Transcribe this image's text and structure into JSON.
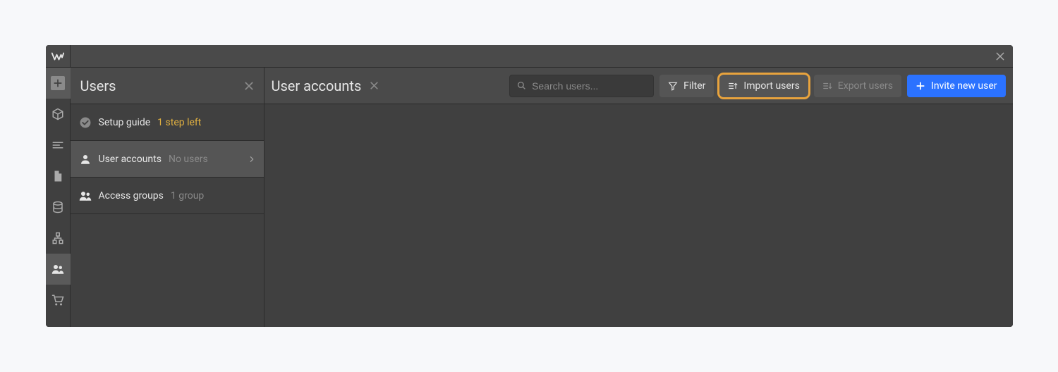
{
  "sidebar": {
    "title": "Users",
    "rows": [
      {
        "label": "Setup guide",
        "meta": "1 step left",
        "metaHighlight": true
      },
      {
        "label": "User accounts",
        "meta": "No users",
        "metaHighlight": false
      },
      {
        "label": "Access groups",
        "meta": "1 group",
        "metaHighlight": false
      }
    ]
  },
  "main": {
    "title": "User accounts",
    "search_placeholder": "Search users...",
    "filter_label": "Filter",
    "import_label": "Import users",
    "export_label": "Export users",
    "invite_label": "Invite new user"
  }
}
